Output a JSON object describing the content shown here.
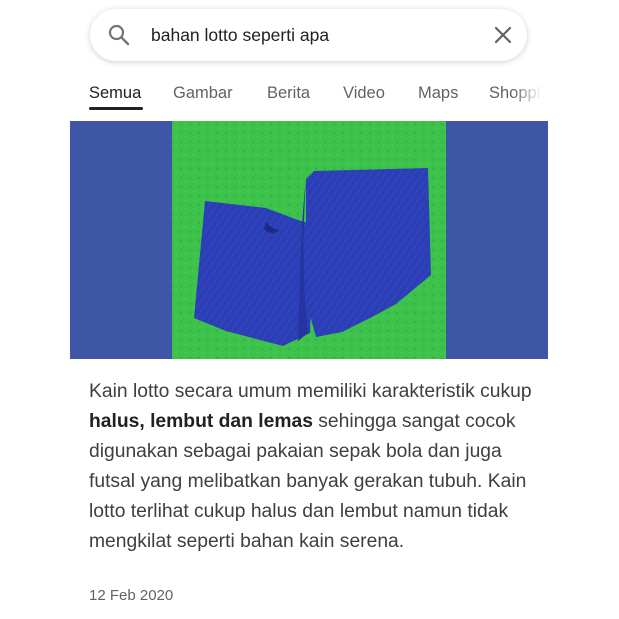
{
  "search": {
    "query": "bahan lotto seperti apa"
  },
  "tabs": [
    {
      "label": "Semua",
      "active": true
    },
    {
      "label": "Gambar",
      "active": false
    },
    {
      "label": "Berita",
      "active": false
    },
    {
      "label": "Video",
      "active": false
    },
    {
      "label": "Maps",
      "active": false
    },
    {
      "label": "Shopping",
      "active": false
    }
  ],
  "result": {
    "snippet_before": "Kain lotto secara umum memiliki karakteristik cukup ",
    "snippet_bold": "halus, lembut dan lemas",
    "snippet_after": " sehingga sangat cocok digunakan sebagai pakaian sepak bola dan juga futsal yang melibatkan banyak gerakan tubuh. Kain lotto terlihat cukup halus dan lembut namun tidak mengkilat seperti bahan kain serena.",
    "date": "12 Feb 2020"
  },
  "colors": {
    "image_side_blue": "#3f56a6",
    "image_green": "#3cc04a",
    "fabric_blue": "#2c3eb6",
    "text_dark": "#202124",
    "text_gray": "#5f6368"
  },
  "icons": {
    "search": "search-icon",
    "clear": "close-icon"
  }
}
